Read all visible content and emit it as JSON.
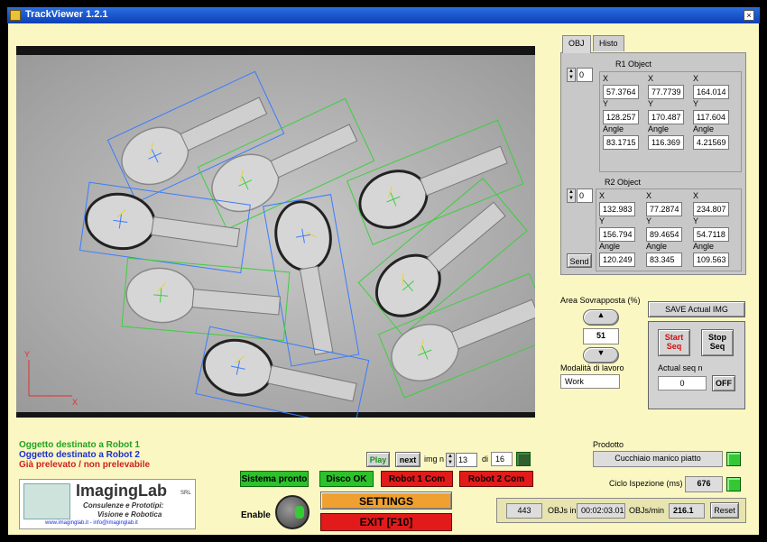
{
  "window": {
    "title": "TrackViewer 1.2.1",
    "close_glyph": "×"
  },
  "tabs": [
    {
      "label": "OBJ"
    },
    {
      "label": "Histo"
    }
  ],
  "r1": {
    "title": "R1 Object",
    "index": "0",
    "columns": [
      {
        "x_label": "X",
        "x": "57.3764",
        "y_label": "Y",
        "y": "128.257",
        "angle_label": "Angle",
        "angle": "83.1715"
      },
      {
        "x_label": "X",
        "x": "77.7739",
        "y_label": "Y",
        "y": "170.487",
        "angle_label": "Angle",
        "angle": "116.369"
      },
      {
        "x_label": "X",
        "x": "164.014",
        "y_label": "Y",
        "y": "117.604",
        "angle_label": "Angle",
        "angle": "4.21569"
      }
    ]
  },
  "r2": {
    "title": "R2 Object",
    "index": "0",
    "columns": [
      {
        "x_label": "X",
        "x": "132.983",
        "y_label": "Y",
        "y": "156.794",
        "angle_label": "Angle",
        "angle": "120.249"
      },
      {
        "x_label": "X",
        "x": "77.2874",
        "y_label": "Y",
        "y": "89.4654",
        "angle_label": "Angle",
        "angle": "83.345"
      },
      {
        "x_label": "X",
        "x": "234.807",
        "y_label": "Y",
        "y": "54.7118",
        "angle_label": "Angle",
        "angle": "109.563"
      }
    ],
    "send_label": "Send"
  },
  "overlap": {
    "label": "Area Sovrapposta (%)",
    "value": "51"
  },
  "mode": {
    "label": "Modalità di lavoro",
    "value": "Work"
  },
  "save_img_label": "SAVE Actual IMG",
  "sequence": {
    "start_label": "Start Seq",
    "stop_label": "Stop Seq",
    "actual_label": "Actual seq n",
    "actual_value": "0",
    "off_label": "OFF"
  },
  "legend": {
    "robot1": "Oggetto destinato a Robot 1",
    "robot2": "Oggetto destinato a Robot 2",
    "taken": "Già prelevato / non prelevabile",
    "colors": {
      "robot1": "#1fa31f",
      "robot2": "#1a2fd0",
      "taken": "#d02020"
    }
  },
  "playback": {
    "play_label": "Play",
    "next_label": "next",
    "img_label": "img n",
    "img_value": "13",
    "of_label": "di",
    "total_value": "16"
  },
  "status_buttons": {
    "sistema": "Sistema pronto",
    "disco": "Disco OK",
    "robot1": "Robot 1 Com",
    "robot2": "Robot 2 Com"
  },
  "enable_label": "Enable",
  "settings_label": "SETTINGS",
  "exit_label": "EXIT [F10]",
  "product": {
    "label": "Prodotto",
    "value": "Cucchiaio manico piatto"
  },
  "cycle": {
    "label": "Ciclo Ispezione (ms)",
    "value": "676"
  },
  "counters": {
    "objs_value": "443",
    "objs_in_label": "OBJs in",
    "time_value": "00:02:03.01",
    "rate_label": "OBJs/min",
    "rate_value": "216.1",
    "reset_label": "Reset"
  },
  "logo": {
    "name": "ImagingLab",
    "suffix": "SRL",
    "line1": "Consulenze e Prototipi:",
    "line2": "Visione e Robotica",
    "footer": "www.imaginglab.it  -  info@imaginglab.it"
  },
  "axis": {
    "x_label": "X",
    "y_label": "Y"
  },
  "viewer": {
    "robot1_color": "#3ecf3e",
    "robot2_color": "#3a7cff"
  }
}
